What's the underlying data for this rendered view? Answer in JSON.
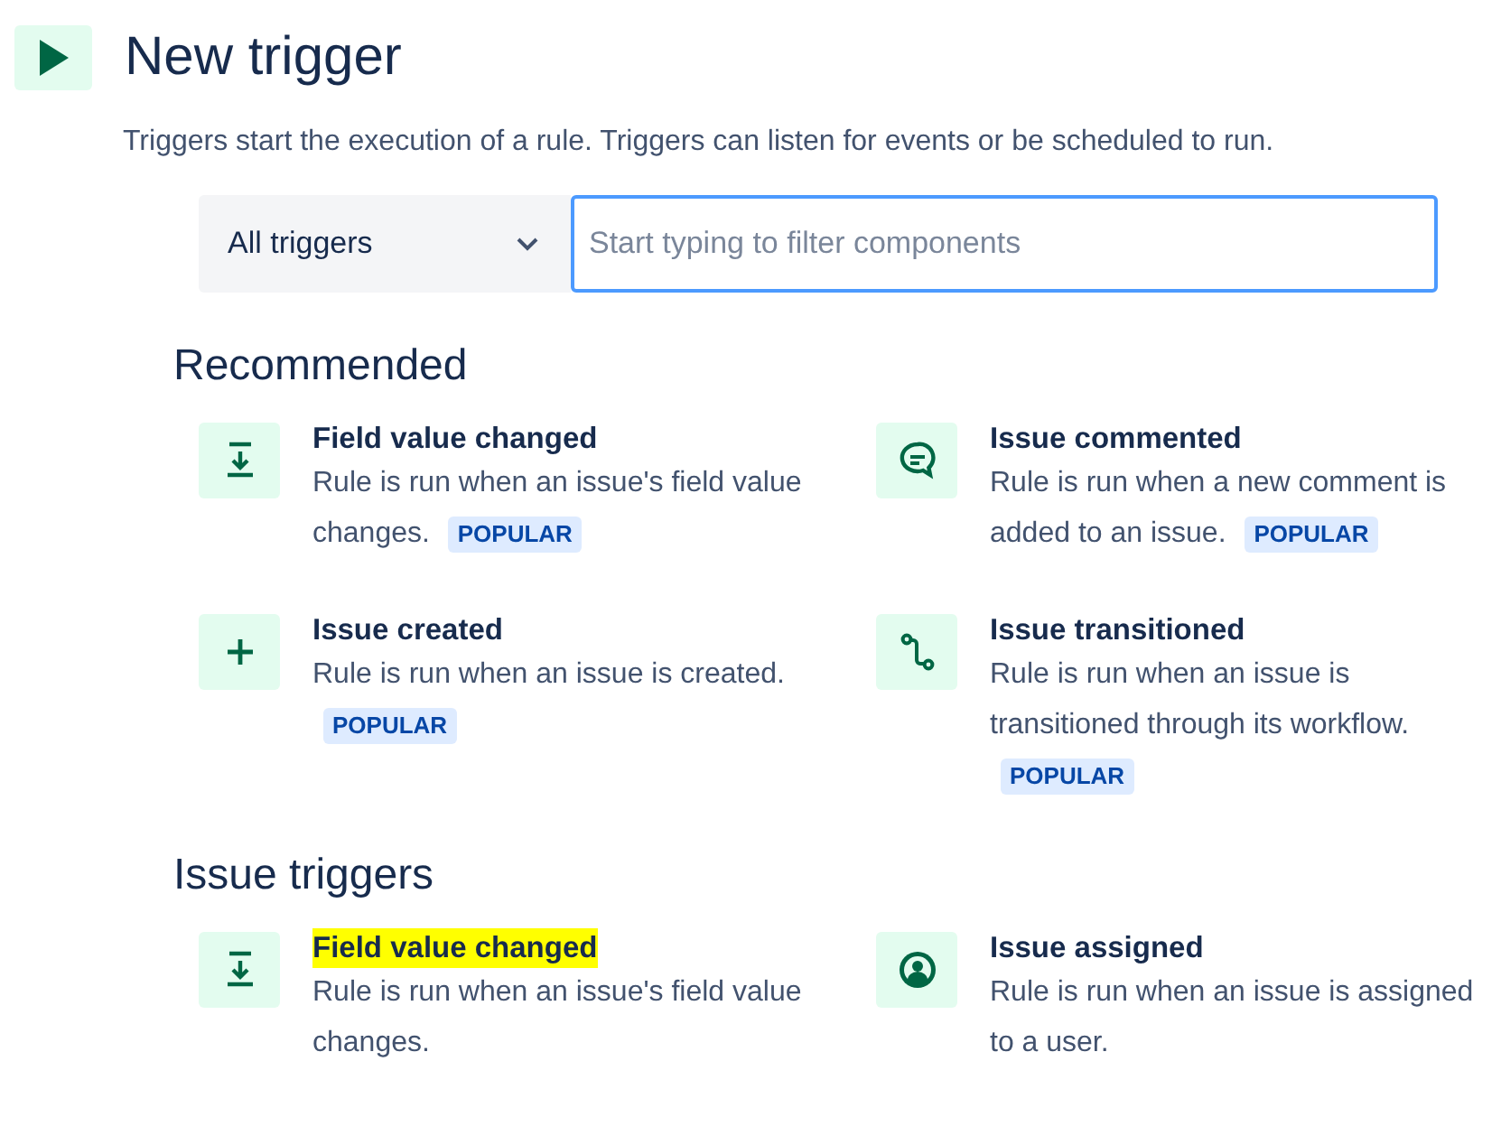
{
  "header": {
    "title": "New trigger",
    "description": "Triggers start the execution of a rule. Triggers can listen for events or be scheduled to run."
  },
  "filter": {
    "category": "All triggers",
    "placeholder": "Start typing to filter components"
  },
  "sections": [
    {
      "heading": "Recommended",
      "items": [
        {
          "kind": "field",
          "title": "Field value changed",
          "description": "Rule is run when an issue's field value changes.",
          "badge": "POPULAR",
          "highlighted": false
        },
        {
          "kind": "comment",
          "title": "Issue commented",
          "description": "Rule is run when a new comment is added to an issue.",
          "badge": "POPULAR",
          "highlighted": false
        },
        {
          "kind": "plus",
          "title": "Issue created",
          "description": "Rule is run when an issue is created.",
          "badge": "POPULAR",
          "highlighted": false
        },
        {
          "kind": "transition",
          "title": "Issue transitioned",
          "description": "Rule is run when an issue is transitioned through its workflow.",
          "badge": "POPULAR",
          "highlighted": false
        }
      ]
    },
    {
      "heading": "Issue triggers",
      "items": [
        {
          "kind": "field",
          "title": "Field value changed",
          "description": "Rule is run when an issue's field value changes.",
          "highlighted": true
        },
        {
          "kind": "person",
          "title": "Issue assigned",
          "description": "Rule is run when an issue is assigned to a user.",
          "highlighted": false
        }
      ]
    }
  ]
}
